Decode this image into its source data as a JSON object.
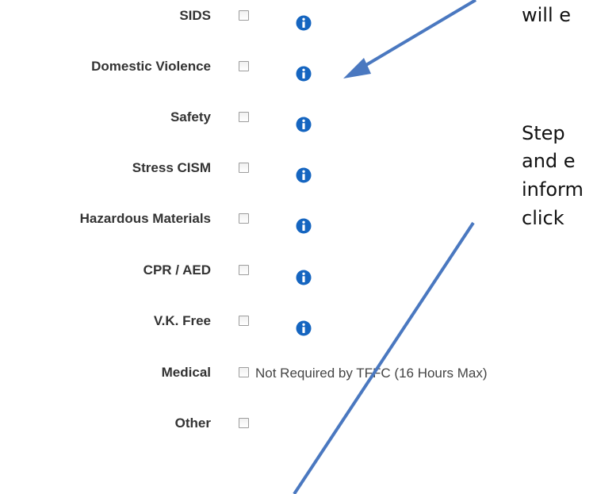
{
  "form": {
    "rows": [
      {
        "label": "SIDS"
      },
      {
        "label": "Domestic Violence"
      },
      {
        "label": "Safety"
      },
      {
        "label": "Stress CISM"
      },
      {
        "label": "Hazardous Materials"
      },
      {
        "label": "CPR / AED"
      },
      {
        "label": "V.K. Free"
      },
      {
        "label": "Medical",
        "note": "Not Required by TFFC (16 Hours Max)"
      },
      {
        "label": "Other"
      }
    ]
  },
  "callout": {
    "line1": "will e",
    "line2": "Step",
    "line3": "and e",
    "line4": "inform",
    "line5": "click"
  },
  "colors": {
    "info_icon": "#1565c0",
    "arrow": "#4a78c0",
    "label_text": "#333333"
  },
  "icons": {
    "info": "info-icon",
    "checkbox": "checkbox"
  }
}
